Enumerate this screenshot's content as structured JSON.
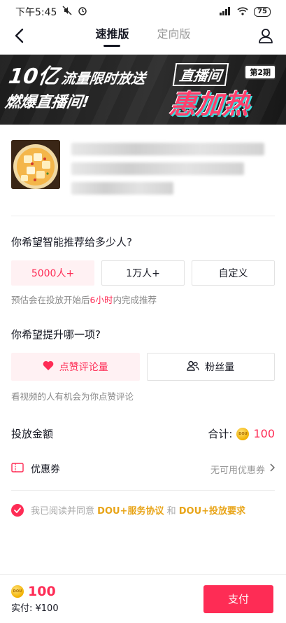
{
  "status_bar": {
    "time": "下午5:45",
    "battery": "75"
  },
  "nav": {
    "tabs": [
      {
        "label": "速推版",
        "active": true
      },
      {
        "label": "定向版",
        "active": false
      }
    ]
  },
  "banner": {
    "left_big": "10亿",
    "left_line1": "流量限时放送",
    "left_line2": "燃爆直播间!",
    "right_title": "直播间",
    "right_badge": "第2期",
    "right_big": "惠加热"
  },
  "targeting": {
    "question": "你希望智能推荐给多少人?",
    "options": [
      {
        "label": "5000人+",
        "selected": true
      },
      {
        "label": "1万人+",
        "selected": false
      },
      {
        "label": "自定义",
        "selected": false
      }
    ],
    "hint_prefix": "预估会在投放开始后",
    "hint_highlight": "6小时",
    "hint_suffix": "内完成推荐"
  },
  "goal": {
    "question": "你希望提升哪一项?",
    "options": [
      {
        "label": "点赞评论量",
        "icon": "heart-icon",
        "selected": true
      },
      {
        "label": "粉丝量",
        "icon": "users-icon",
        "selected": false
      }
    ],
    "hint": "看视频的人有机会为你点赞评论"
  },
  "amount": {
    "label": "投放金额",
    "total_label": "合计:",
    "total_value": "100"
  },
  "coupon": {
    "label": "优惠券",
    "status": "无可用优惠券"
  },
  "agreement": {
    "prefix": "我已阅读并同意",
    "link1": "DOU+服务协议",
    "and": "和",
    "link2": "DOU+投放要求"
  },
  "bottom": {
    "amount": "100",
    "paid_label": "实付: ¥100",
    "pay_button": "支付"
  },
  "colors": {
    "accent": "#fe2c55",
    "link": "#e8a417"
  }
}
